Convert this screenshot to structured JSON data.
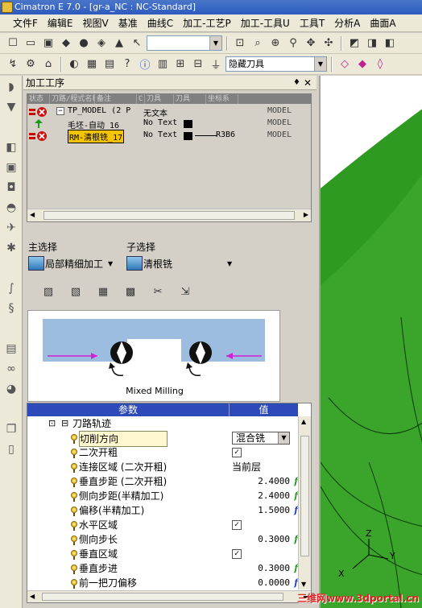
{
  "window": {
    "title": "Cimatron E 7.0 - [gr-a_NC : NC-Standard]"
  },
  "menubar": {
    "items": [
      "文件F",
      "编辑E",
      "视图V",
      "基准",
      "曲线C",
      "加工-工艺P",
      "加工-工具U",
      "工具T",
      "分析A",
      "曲面A"
    ]
  },
  "toolbar": {
    "tool_filter_value": "隐藏刀具"
  },
  "panel": {
    "title": "加工工序",
    "pin_glyph": "♦",
    "close_glyph": "✕",
    "tree_columns": [
      "状态",
      "刀路/程式名称",
      "备注",
      "C",
      "刀具",
      "刀具",
      "坐标系"
    ],
    "tree_rows": [
      {
        "name": "TP_MODEL (2 P",
        "comment": "无文本",
        "tool": "",
        "csys": "MODEL",
        "status": "error",
        "expand": "−"
      },
      {
        "name": "毛坯-自动_16",
        "comment": "No Text",
        "tool": "",
        "csys": "MODEL",
        "status": "ok"
      },
      {
        "name": "RM-清根铣_17",
        "comment": "No Text",
        "tool": "R3B6",
        "csys": "MODEL",
        "status": "error",
        "selected": true
      }
    ]
  },
  "selector": {
    "main_label": "主选择",
    "sub_label": "子选择",
    "main_value": "局部精细加工",
    "sub_value": "清根铣"
  },
  "preview": {
    "caption": "Mixed Milling"
  },
  "params": {
    "col_param": "参数",
    "col_value": "值",
    "group": "刀路轨迹",
    "rows": [
      {
        "label": "切削方向",
        "type": "dropdown",
        "value": "混合铣"
      },
      {
        "label": "二次开粗",
        "type": "check",
        "value": "✓"
      },
      {
        "label": "连接区域 (二次开粗)",
        "type": "text",
        "value": "当前层"
      },
      {
        "label": "垂直步距 (二次开粗)",
        "type": "num",
        "value": "2.4000",
        "mark": "f"
      },
      {
        "label": "侧向步距(半精加工)",
        "type": "num",
        "value": "2.4000",
        "mark": "f"
      },
      {
        "label": "偏移(半精加工)",
        "type": "num",
        "value": "1.5000",
        "mark": "f",
        "mark_color": "blue"
      },
      {
        "label": "水平区域",
        "type": "check",
        "value": "✓"
      },
      {
        "label": "侧向步长",
        "type": "num",
        "value": "0.3000",
        "mark": "f"
      },
      {
        "label": "垂直区域",
        "type": "check",
        "value": "✓"
      },
      {
        "label": "垂直步进",
        "type": "num",
        "value": "0.3000",
        "mark": "f"
      },
      {
        "label": "前一把刀偏移",
        "type": "num",
        "value": "0.0000",
        "mark": "f",
        "mark_color": "blue"
      }
    ]
  },
  "viewport": {
    "axis_x": "X",
    "axis_y": "Y",
    "axis_z": "Z"
  },
  "watermark": {
    "text": "三维网www.3dportal.cn"
  }
}
